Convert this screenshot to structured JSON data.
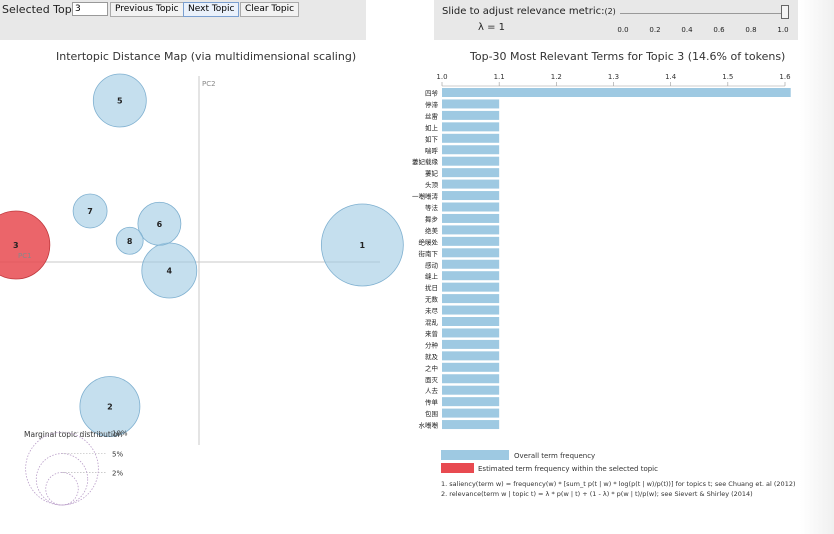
{
  "controls": {
    "selected_topic_label": "Selected Topic:",
    "selected_topic_value": "3",
    "prev_label": "Previous Topic",
    "next_label": "Next Topic",
    "clear_label": "Clear Topic",
    "slider_label": "Slide to adjust relevance metric:",
    "slider_note": "(2)",
    "lambda_text": "λ = 1",
    "lambda_value": 1,
    "slider_ticks": [
      "0.0",
      "0.2",
      "0.4",
      "0.6",
      "0.8",
      "1.0"
    ]
  },
  "legend": {
    "overall_label": "Overall term frequency",
    "selected_label": "Estimated term frequency within the selected topic"
  },
  "footnotes": {
    "note1": "1. saliency(term w) = frequency(w) * [sum_t p(t | w) * log(p(t | w)/p(t))] for topics t; see Chuang et. al (2012)",
    "note2": "2. relevance(term w | topic t) = λ * p(w | t) + (1 - λ) * p(w | t)/p(w); see Sievert & Shirley (2014)"
  },
  "colors": {
    "bubble": "#9ec9e2",
    "bubble_selected": "#e84a50",
    "bar_overall": "#9ec9e2",
    "bar_selected": "#e84a50"
  },
  "chart_data": [
    {
      "type": "scatter",
      "title": "Intertopic Distance Map (via multidimensional scaling)",
      "xlabel": "PC1",
      "ylabel": "PC2",
      "selected_topic": 3,
      "points": [
        {
          "label": "1",
          "x": 0.33,
          "y": 0.04,
          "size": 8.2
        },
        {
          "label": "2",
          "x": -0.18,
          "y": -0.34,
          "size": 6.0
        },
        {
          "label": "3",
          "x": -0.37,
          "y": 0.04,
          "size": 6.8
        },
        {
          "label": "4",
          "x": -0.06,
          "y": -0.02,
          "size": 5.5
        },
        {
          "label": "5",
          "x": -0.16,
          "y": 0.38,
          "size": 5.3
        },
        {
          "label": "6",
          "x": -0.08,
          "y": 0.09,
          "size": 4.3
        },
        {
          "label": "7",
          "x": -0.22,
          "y": 0.12,
          "size": 3.4
        },
        {
          "label": "8",
          "x": -0.14,
          "y": 0.05,
          "size": 2.7
        }
      ],
      "size_legend": {
        "title": "Marginal topic distribution",
        "items": [
          {
            "label": "2%",
            "value": 2
          },
          {
            "label": "5%",
            "value": 5
          },
          {
            "label": "10%",
            "value": 10
          }
        ]
      }
    },
    {
      "type": "bar",
      "orientation": "horizontal",
      "title": "Top-30 Most Relevant Terms for Topic 3 (14.6% of tokens)",
      "xlim": [
        1.0,
        1.6
      ],
      "xticks": [
        "1.0",
        "1.1",
        "1.2",
        "1.3",
        "1.4",
        "1.5",
        "1.6"
      ],
      "categories": [
        "四爷",
        "停滞",
        "丝雷",
        "如上",
        "如下",
        "喘呼",
        "萋妃载缘",
        "萋妃",
        "头顶",
        "一嘲嘲涛",
        "等法",
        "舞步",
        "绝美",
        "绝暖处",
        "街南下",
        "感动",
        "缝上",
        "扰日",
        "无数",
        "未尽",
        "混乱",
        "来曾",
        "分种",
        "就及",
        "之中",
        "面灭",
        "人去",
        "传单",
        "包围",
        "水嘲嘲"
      ],
      "series": [
        {
          "values": [
            1.61,
            1.1,
            1.1,
            1.1,
            1.1,
            1.1,
            1.1,
            1.1,
            1.1,
            1.1,
            1.1,
            1.1,
            1.1,
            1.1,
            1.1,
            1.1,
            1.1,
            1.1,
            1.1,
            1.1,
            1.1,
            1.1,
            1.1,
            1.1,
            1.1,
            1.1,
            1.1,
            1.1,
            1.1,
            1.1
          ]
        }
      ]
    }
  ]
}
